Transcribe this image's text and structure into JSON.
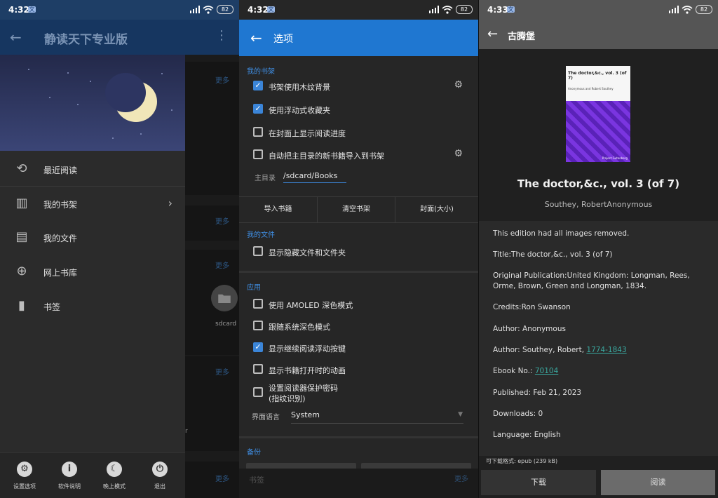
{
  "left": {
    "time": "4:32",
    "battery": "82",
    "app_title": "静读天下专业版",
    "drawer_items": [
      {
        "label": "最近阅读",
        "icon": "history-icon"
      },
      {
        "label": "我的书架",
        "icon": "bookshelf-icon"
      },
      {
        "label": "我的文件",
        "icon": "file-icon"
      },
      {
        "label": "网上书库",
        "icon": "globe-icon"
      },
      {
        "label": "书签",
        "icon": "bookmark-icon"
      }
    ],
    "bottom_buttons": [
      {
        "label": "设置选项",
        "icon": "gear-icon"
      },
      {
        "label": "软件说明",
        "icon": "info-icon"
      },
      {
        "label": "晚上模式",
        "icon": "moon-icon"
      },
      {
        "label": "退出",
        "icon": "power-icon"
      }
    ],
    "bg_more": "更多",
    "bg_folder_label": "sdcard",
    "bg_partial": "r"
  },
  "middle": {
    "time": "4:32",
    "battery": "82",
    "title": "选项",
    "section_bookshelf": "我的书架",
    "opt1": "书架使用木纹背景",
    "opt2": "使用浮动式收藏夹",
    "opt3": "在封面上显示阅读进度",
    "opt4": "自动把主目录的新书籍导入到书架",
    "dir_label": "主目录",
    "dir_value": "/sdcard/Books",
    "btn_import": "导入书籍",
    "btn_clear": "清空书架",
    "btn_cover": "封面(大小)",
    "section_files": "我的文件",
    "opt5": "显示隐藏文件和文件夹",
    "section_app": "应用",
    "opt6": "使用 AMOLED 深色模式",
    "opt7": "跟随系统深色模式",
    "opt8": "显示继续阅读浮动按键",
    "opt9": "显示书籍打开时的动画",
    "opt10_line1": "设置阅读器保护密码",
    "opt10_line2": "(指纹识别)",
    "lang_label": "界面语言",
    "lang_value": "System",
    "section_backup": "备份",
    "footer_left": "书签",
    "footer_right": "更多"
  },
  "right": {
    "time": "4:33",
    "battery": "82",
    "title": "古腾堡",
    "cover_title": "The doctor,&c., vol. 3 (of 7)",
    "cover_author": "Anonymous and Robert Southey",
    "cover_publisher": "Project Gutenberg",
    "book_title": "The doctor,&c., vol. 3 (of 7)",
    "book_author": "Southey, RobertAnonymous",
    "d1": "This edition had all images removed.",
    "d2": "Title:The doctor,&c., vol. 3 (of 7)",
    "d3": "Original Publication:United Kingdom: Longman, Rees, Orme, Brown, Green and Longman, 1834.",
    "d4": "Credits:Ron Swanson",
    "d5": "Author: Anonymous",
    "d6_prefix": "Author: Southey, Robert, ",
    "d6_link": "1774-1843",
    "d7_prefix": "Ebook No.: ",
    "d7_link": "70104",
    "d8": "Published: Feb 21, 2023",
    "d9": "Downloads: 0",
    "d10": "Language: English",
    "format_line": "可下载格式: epub (239 kB)",
    "btn_download": "下载",
    "btn_read": "阅读"
  }
}
